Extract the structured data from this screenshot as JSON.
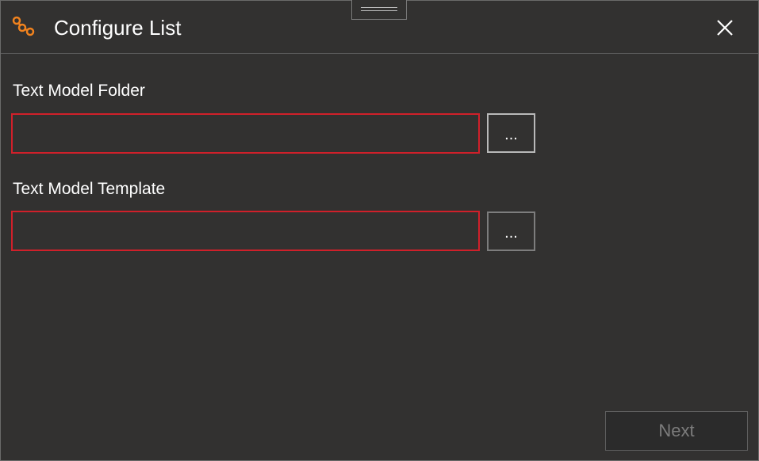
{
  "window": {
    "title": "Configure List",
    "close_icon": "close-icon",
    "app_icon": "workflow-nodes-icon",
    "accent_color": "#f0821e"
  },
  "form": {
    "folder": {
      "label": "Text Model Folder",
      "value": "",
      "browse_label": "..."
    },
    "template": {
      "label": "Text Model Template",
      "value": "",
      "browse_label": "..."
    },
    "invalid_border_color": "#d0202a"
  },
  "footer": {
    "next_label": "Next",
    "next_enabled": false
  }
}
